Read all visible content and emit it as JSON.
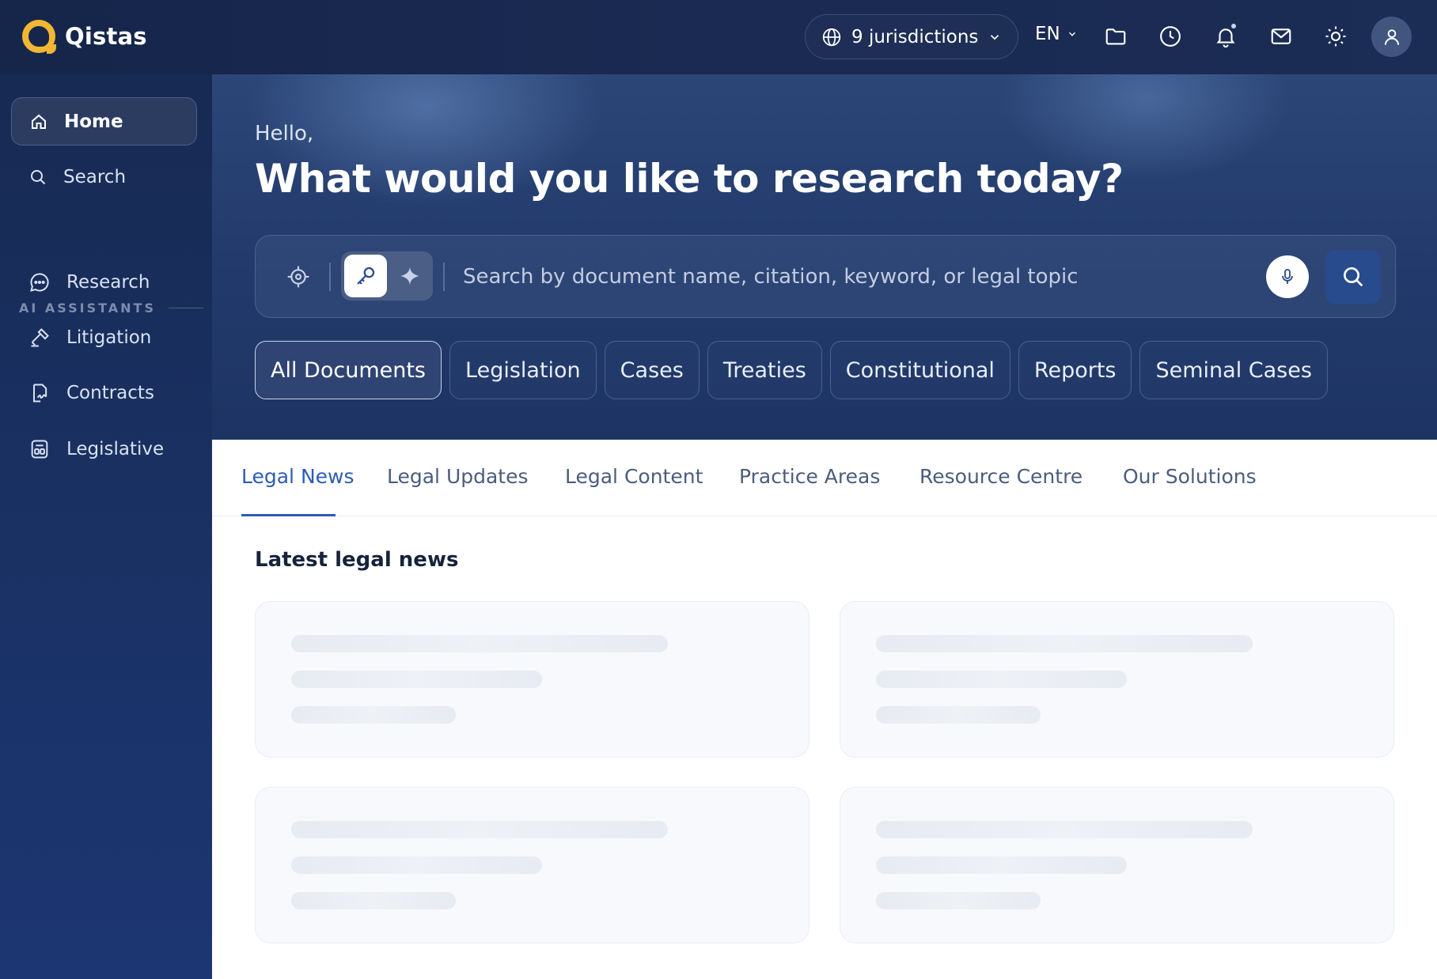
{
  "app": {
    "name": "Qistas"
  },
  "topbar": {
    "jurisdictions_label": "9 jurisdictions",
    "language": "EN",
    "icons": [
      "globe-icon",
      "chevron-down-icon",
      "folder-icon",
      "clock-icon",
      "bell-icon",
      "mail-icon",
      "sun-icon",
      "user-icon"
    ]
  },
  "sidebar": {
    "items": [
      {
        "label": "Home",
        "icon": "home-icon",
        "active": true
      },
      {
        "label": "Search",
        "icon": "search-icon",
        "active": false
      }
    ],
    "section_label": "AI ASSISTANTS",
    "assistants": [
      {
        "label": "Research",
        "icon": "chat-icon"
      },
      {
        "label": "Litigation",
        "icon": "gavel-icon"
      },
      {
        "label": "Contracts",
        "icon": "contract-icon"
      },
      {
        "label": "Legislative",
        "icon": "legislative-icon"
      }
    ]
  },
  "hero": {
    "greeting": "Hello,",
    "headline": "What would you like to research today?",
    "search_placeholder": "Search by document name, citation, keyword, or legal topic",
    "filters": [
      "All Documents",
      "Legislation",
      "Cases",
      "Treaties",
      "Constitutional",
      "Reports",
      "Seminal Cases"
    ],
    "active_filter": "All Documents"
  },
  "content": {
    "tabs": [
      "Legal News",
      "Legal Updates",
      "Legal Content",
      "Practice Areas",
      "Resource Centre",
      "Our Solutions"
    ],
    "active_tab": "Legal News",
    "section_title": "Latest legal news"
  },
  "colors": {
    "brand_accent": "#f1b733",
    "active_tab": "#2e5bb7",
    "sidebar_bg": "#1a3266",
    "hero_bg": "#223a6b"
  }
}
